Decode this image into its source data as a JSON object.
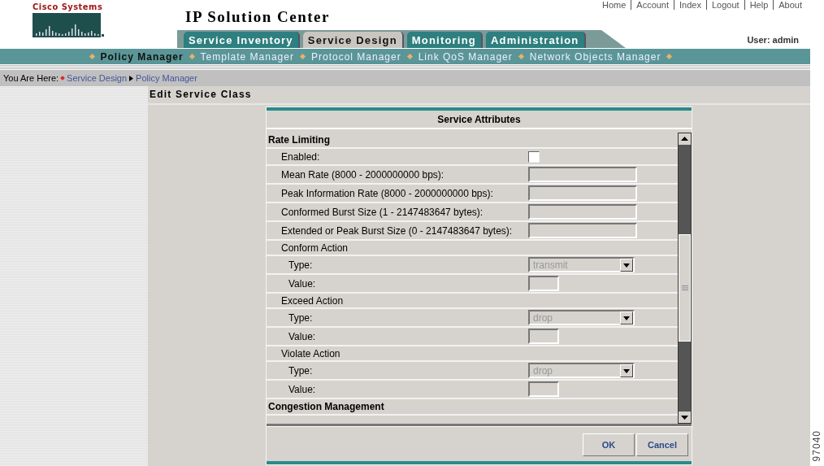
{
  "top_links": [
    "Home",
    "Account",
    "Index",
    "Logout",
    "Help",
    "About"
  ],
  "brand": {
    "company": "Cisco Systems",
    "product": "IP Solution Center"
  },
  "tabs": [
    {
      "label": "Service Inventory",
      "selected": false
    },
    {
      "label": "Service Design",
      "selected": true
    },
    {
      "label": "Monitoring",
      "selected": false
    },
    {
      "label": "Administration",
      "selected": false
    }
  ],
  "user": "User: admin",
  "subnav": [
    {
      "label": "Policy Manager",
      "selected": true
    },
    {
      "label": "Template Manager",
      "selected": false
    },
    {
      "label": "Protocol Manager",
      "selected": false
    },
    {
      "label": "Link QoS Manager",
      "selected": false
    },
    {
      "label": "Network Objects Manager",
      "selected": false
    }
  ],
  "breadcrumb": {
    "prefix": "You Are Here:",
    "items": [
      "Service Design",
      "Policy Manager"
    ]
  },
  "page_title": "Edit Service Class",
  "panel": {
    "title": "Service Attributes",
    "rows": [
      {
        "kind": "section",
        "label": "Rate Limiting"
      },
      {
        "kind": "checkbox",
        "label": "Enabled:",
        "checked": false
      },
      {
        "kind": "field",
        "label": "Mean Rate (8000  - 2000000000 bps):"
      },
      {
        "kind": "field",
        "label": "Peak Information Rate (8000  - 2000000000 bps):"
      },
      {
        "kind": "field",
        "label": "Conformed Burst Size (1  - 2147483647 bytes):"
      },
      {
        "kind": "field",
        "label": "Extended or Peak Burst Size (0  - 2147483647 bytes):"
      },
      {
        "kind": "group",
        "label": "Conform Action"
      },
      {
        "kind": "select",
        "label": "Type:",
        "value": "transmit",
        "disabled": true
      },
      {
        "kind": "small_field",
        "label": "Value:"
      },
      {
        "kind": "group",
        "label": "Exceed Action"
      },
      {
        "kind": "select",
        "label": "Type:",
        "value": "drop",
        "disabled": true
      },
      {
        "kind": "small_field",
        "label": "Value:"
      },
      {
        "kind": "group",
        "label": "Violate Action"
      },
      {
        "kind": "select",
        "label": "Type:",
        "value": "drop",
        "disabled": true
      },
      {
        "kind": "small_field",
        "label": "Value:"
      },
      {
        "kind": "section",
        "label": "Congestion Management"
      }
    ],
    "buttons": [
      "OK",
      "Cancel"
    ]
  },
  "figure_number": "97040"
}
